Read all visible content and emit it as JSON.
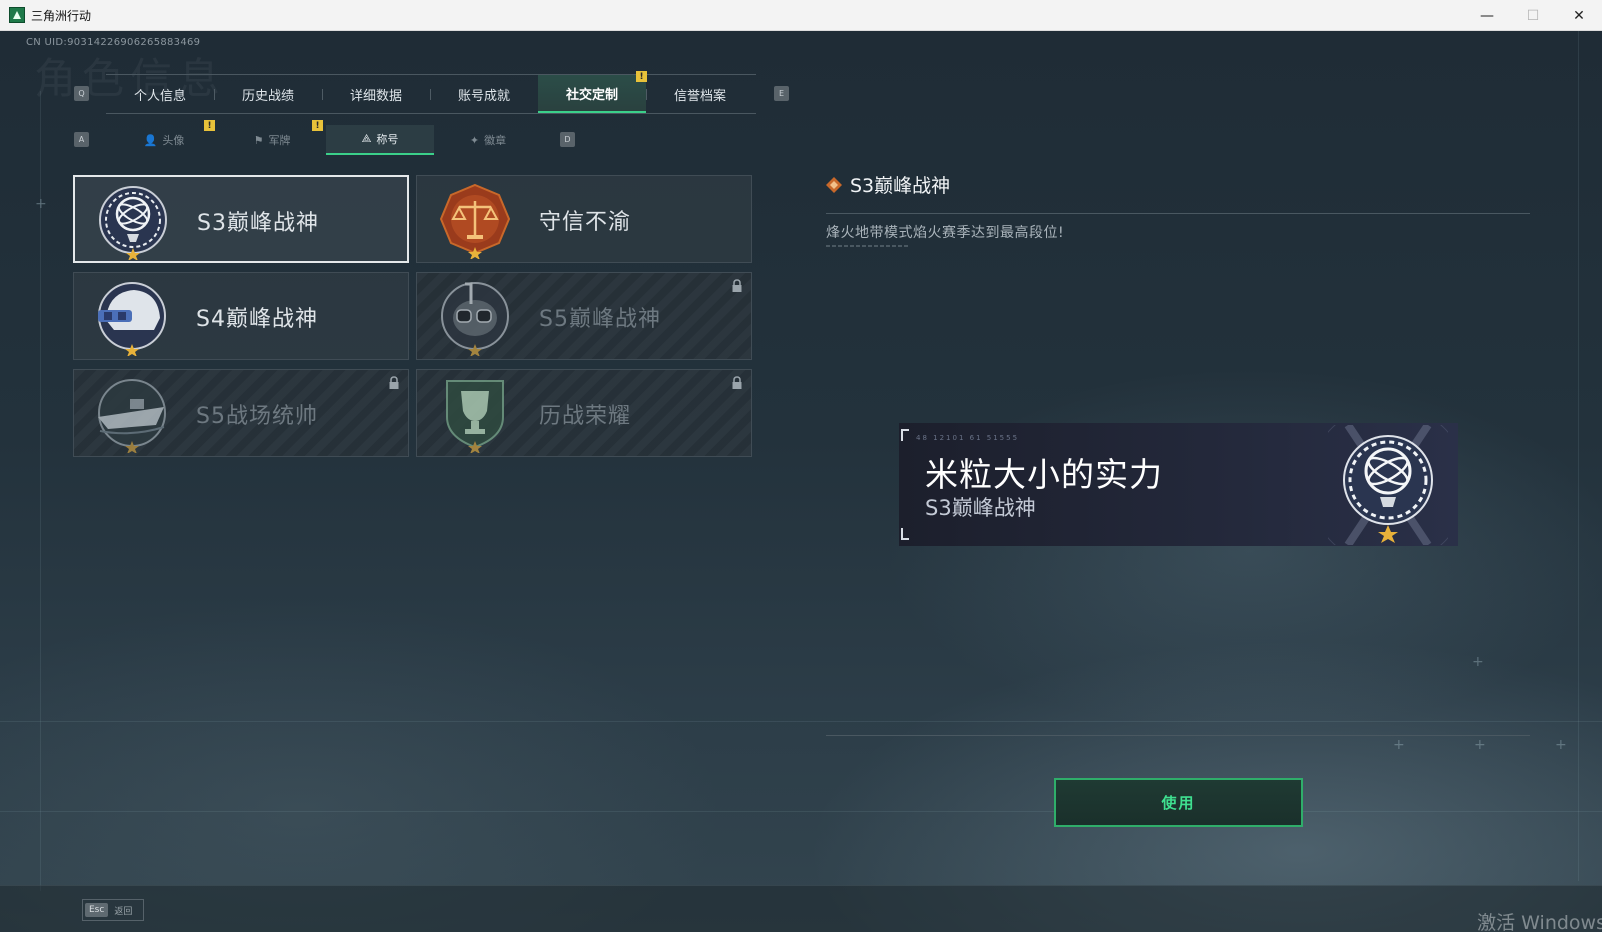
{
  "window": {
    "title": "三角洲行动",
    "minimize_glyph": "—",
    "maximize_glyph": "☐",
    "close_glyph": "✕"
  },
  "page": {
    "uid": "CN UID:9031422690626588346​9",
    "bg_title": "角色信息"
  },
  "main_tabs": {
    "prev_key": "Q",
    "next_key": "E",
    "items": [
      {
        "label": "个人信息",
        "active": false
      },
      {
        "label": "历史战绩",
        "active": false
      },
      {
        "label": "详细数据",
        "active": false
      },
      {
        "label": "账号成就",
        "active": false
      },
      {
        "label": "社交定制",
        "active": true,
        "badge": "!"
      },
      {
        "label": "信誉档案",
        "active": false
      }
    ]
  },
  "sub_tabs": {
    "prev_key": "A",
    "next_key": "D",
    "items": [
      {
        "label": "头像",
        "icon": "person-icon",
        "glyph": "👤",
        "badge": "!"
      },
      {
        "label": "军牌",
        "icon": "dogtag-icon",
        "glyph": "⚑",
        "badge": "!"
      },
      {
        "label": "称号",
        "icon": "title-icon",
        "glyph": "⟁",
        "active": true
      },
      {
        "label": "徽章",
        "icon": "medal-icon",
        "glyph": "✦"
      }
    ]
  },
  "titles": [
    {
      "name": "S3巅峰战神",
      "emblem": "armillary-emblem-icon",
      "locked": false,
      "selected": true
    },
    {
      "name": "守信不渝",
      "emblem": "scales-emblem-icon",
      "locked": false,
      "selected": false
    },
    {
      "name": "S4巅峰战神",
      "emblem": "helmet-emblem-icon",
      "locked": false,
      "selected": false
    },
    {
      "name": "S5巅峰战神",
      "emblem": "diver-emblem-icon",
      "locked": true,
      "selected": false
    },
    {
      "name": "S5战场统帅",
      "emblem": "boat-emblem-icon",
      "locked": true,
      "selected": false
    },
    {
      "name": "历战荣耀",
      "emblem": "trophy-emblem-icon",
      "locked": true,
      "selected": false
    }
  ],
  "detail": {
    "title": "S3巅峰战神",
    "description": "烽火地带模式焰火赛季达到最高段位!"
  },
  "banner": {
    "code": "48 12101 61 51555",
    "player_name": "米粒大小的实力",
    "title": "S3巅峰战神"
  },
  "actions": {
    "use_label": "使用"
  },
  "footer": {
    "esc_key": "Esc",
    "back_label": "返回",
    "watermark": "激活 Windows"
  },
  "colors": {
    "accent_green": "#3bd08a",
    "badge_yellow": "#e8c23a",
    "emblem_orange": "#c8682a",
    "background": "#1e2a33"
  }
}
